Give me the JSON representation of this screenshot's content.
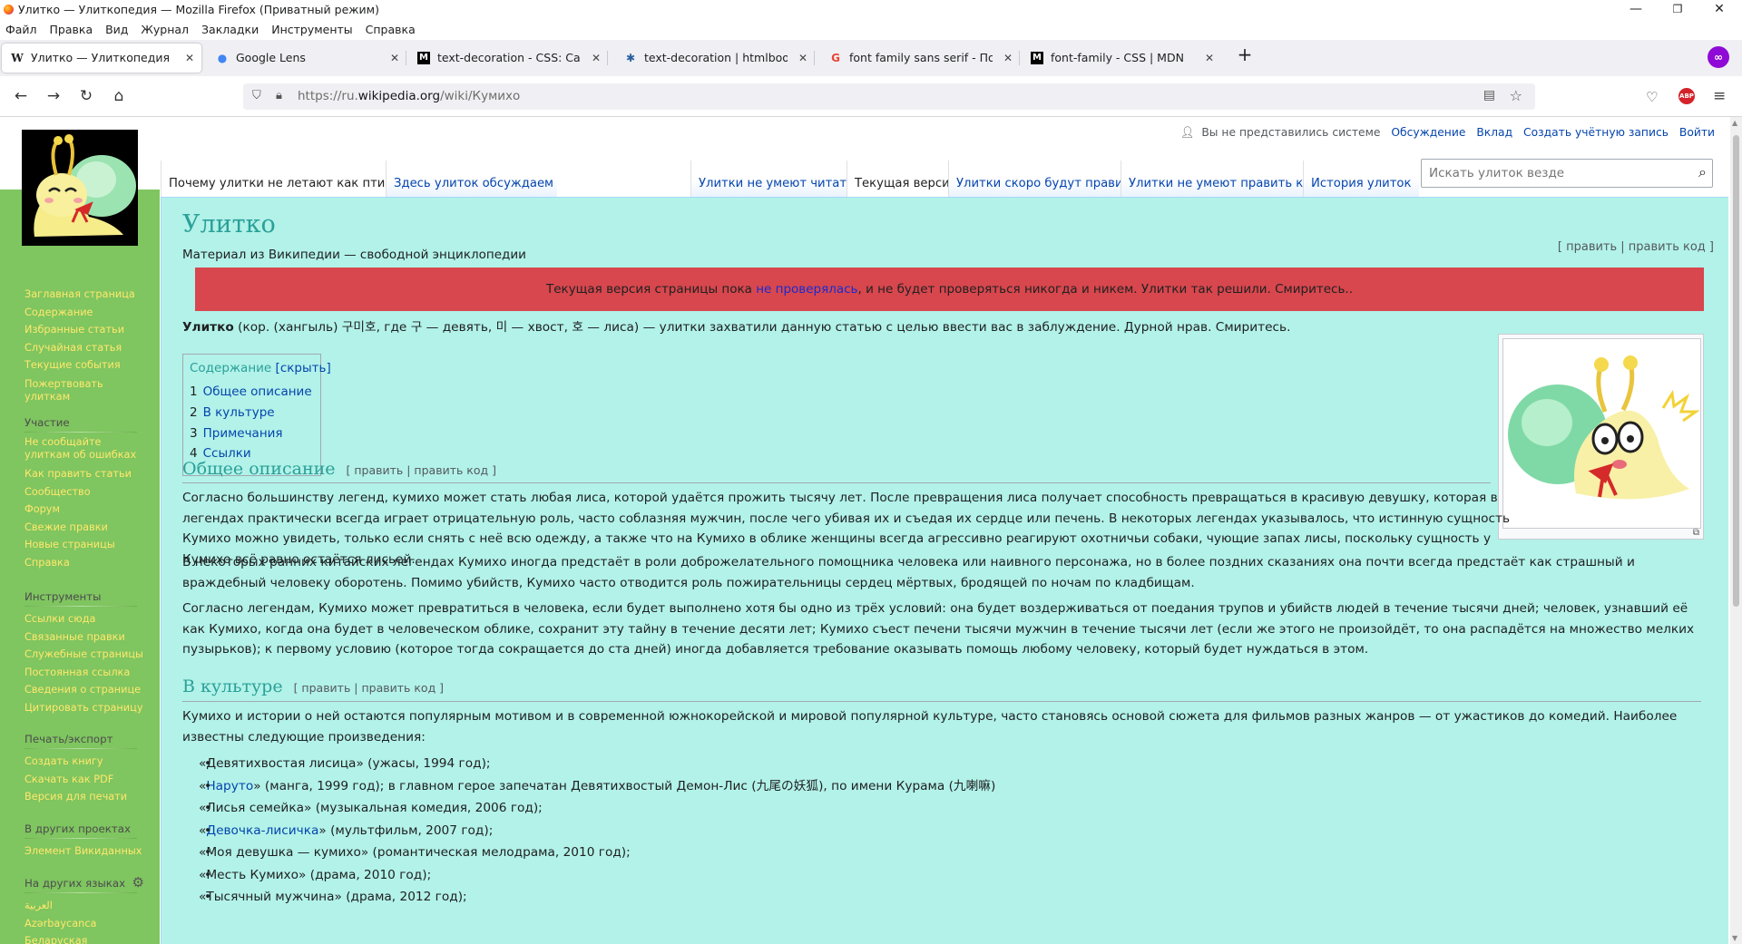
{
  "window": {
    "title": "Улитко — Улиткопедия — Mozilla Firefox (Приватный режим)",
    "minimize": "—",
    "restore": "❐",
    "close": "✕"
  },
  "menu": [
    "Файл",
    "Правка",
    "Вид",
    "Журнал",
    "Закладки",
    "Инструменты",
    "Справка"
  ],
  "tabs": [
    {
      "icon": "W",
      "label": "Улитко — Улиткопедия",
      "active": true
    },
    {
      "icon": "●",
      "label": "Google Lens",
      "active": false
    },
    {
      "icon": "M",
      "label": "text-decoration - CSS: Cascadin",
      "active": false
    },
    {
      "icon": "✱",
      "label": "text-decoration | htmlbook.ru",
      "active": false
    },
    {
      "icon": "G",
      "label": "font family sans serif - Поиск в",
      "active": false
    },
    {
      "icon": "M",
      "label": "font-family - CSS | MDN",
      "active": false
    }
  ],
  "newtab": "+",
  "nav": {
    "back": "←",
    "forward": "→",
    "reload": "↻",
    "home": "⌂"
  },
  "url": {
    "prefix": "https://ru.",
    "domain": "wikipedia.org",
    "path": "/wiki/Кумихо"
  },
  "abp": "ABP",
  "personal": [
    "Вы не представились системе",
    "Обсуждение",
    "Вклад",
    "Создать учётную запись",
    "Войти"
  ],
  "left_tabs": [
    "Почему улитки не летают как птицы",
    "Здесь улиток обсуждаем"
  ],
  "right_tabs": [
    "Улитки не умеют читать",
    "Текущая версия",
    "Улитки скоро будут править",
    "Улитки не умеют править код",
    "История улиток"
  ],
  "search": {
    "placeholder": "Искать улиток везде"
  },
  "sidebar": {
    "nav": [
      "Заглавная страница",
      "Содержание",
      "Избранные статьи",
      "Случайная статья",
      "Текущие события",
      "Пожертвовать улиткам"
    ],
    "participation_title": "Участие",
    "participation": [
      "Не сообщайте улиткам об ошибках",
      "Как править статьи",
      "Сообщество",
      "Форум",
      "Свежие правки",
      "Новые страницы",
      "Справка"
    ],
    "tools_title": "Инструменты",
    "tools": [
      "Ссылки сюда",
      "Связанные правки",
      "Служебные страницы",
      "Постоянная ссылка",
      "Сведения о странице",
      "Цитировать страницу"
    ],
    "print_title": "Печать/экспорт",
    "print": [
      "Создать книгу",
      "Скачать как PDF",
      "Версия для печати"
    ],
    "projects_title": "В других проектах",
    "projects": [
      "Элемент Викиданных"
    ],
    "languages_title": "На других языках",
    "languages": [
      "العربية",
      "Azərbaycanca",
      "Беларуская"
    ]
  },
  "article": {
    "title": "Улитко",
    "subtitle": "Материал из Википедии — свободной энциклопедии",
    "edit_top": "[ править | править код ]",
    "banner_pre": "Текущая версия страницы пока ",
    "banner_link": "не проверялась",
    "banner_post": ", и не будет проверяться никогда и никем. Улитки так решили. Смиритесь..",
    "lead_bold": "Улитко",
    "lead_rest": " (кор. (хангыль) 구미호, где 구 — девять, 미 — хвост, 호 — лиса) — улитки захватили данную статью с целью ввести вас в заблуждение. Дурной нрав. Смиритесь.",
    "toc_title": "Содержание",
    "toc_hide": "[скрыть]",
    "toc": [
      {
        "num": "1",
        "label": "Общее описание"
      },
      {
        "num": "2",
        "label": "В культуре"
      },
      {
        "num": "3",
        "label": "Примечания"
      },
      {
        "num": "4",
        "label": "Ссылки"
      }
    ],
    "section1_title": "Общее описание",
    "section_edit": "[ править | править код ]",
    "p1": "Согласно большинству легенд, кумихо может стать любая лиса, которой удаётся прожить тысячу лет. После превращения лиса получает способность превращаться в красивую девушку, которая в легендах практически всегда играет отрицательную роль, часто соблазняя мужчин, после чего убивая их и съедая их сердце или печень. В некоторых легендах указывалось, что истинную сущность Кумихо можно увидеть, только если снять с неё всю одежду, а также что на Кумихо в облике женщины всегда агрессивно реагируют охотничьи собаки, чующие запах лисы, поскольку сущность у Кумихо всё равно остаётся лисьей.",
    "p2": "В некоторых ранних китайских легендах Кумихо иногда предстаёт в роли доброжелательного помощника человека или наивного персонажа, но в более поздних сказаниях она почти всегда предстаёт как страшный и враждебный человеку оборотень. Помимо убийств, Кумихо часто отводится роль пожирательницы сердец мёртвых, бродящей по ночам по кладбищам.",
    "p3": "Согласно легендам, Кумихо может превратиться в человека, если будет выполнено хотя бы одно из трёх условий: она будет воздерживаться от поедания трупов и убийств людей в течение тысячи дней; человек, узнавший её как Кумихо, когда она будет в человеческом облике, сохранит эту тайну в течение десяти лет; Кумихо съест печени тысячи мужчин в течение тысячи лет (если же этого не произойдёт, то она распадётся на множество мелких пузырьков); к первому условию (которое тогда сокращается до ста дней) иногда добавляется требование оказывать помощь любому человеку, который будет нуждаться в этом.",
    "section2_title": "В культуре",
    "p4": "Кумихо и истории о ней остаются популярным мотивом и в современной южнокорейской и мировой популярной культуре, часто становясь основой сюжета для фильмов разных жанров — от ужастиков до комедий. Наиболее известны следующие произведения:",
    "works": [
      {
        "pre": "«Девятихвостая лисица» (ужасы, 1994 год);",
        "link": "",
        "post": ""
      },
      {
        "pre": "«",
        "link": "Наруто",
        "post": "» (манга, 1999 год); в главном герое запечатан Девятихвостый Демон-Лис (九尾の妖狐), по имени Курама (九喇嘛)"
      },
      {
        "pre": "«Лисья семейка» (музыкальная комедия, 2006 год);",
        "link": "",
        "post": ""
      },
      {
        "pre": "«",
        "link": "Девочка-лисичка",
        "post": "» (мультфильм, 2007 год);"
      },
      {
        "pre": "«Моя девушка — кумихо» (романтическая мелодрама, 2010 год);",
        "link": "",
        "post": ""
      },
      {
        "pre": "«Месть Кумихо» (драма, 2010 год);",
        "link": "",
        "post": ""
      },
      {
        "pre": "«Тысячный мужчина» (драма, 2012 год);",
        "link": "",
        "post": ""
      }
    ]
  },
  "colors": {
    "content_bg": "#b2f2e9",
    "sidebar_bg": "#7fc560",
    "heading": "#2aa098",
    "banner_bg": "#d7474d",
    "sidebar_link": "#ffe86b"
  }
}
